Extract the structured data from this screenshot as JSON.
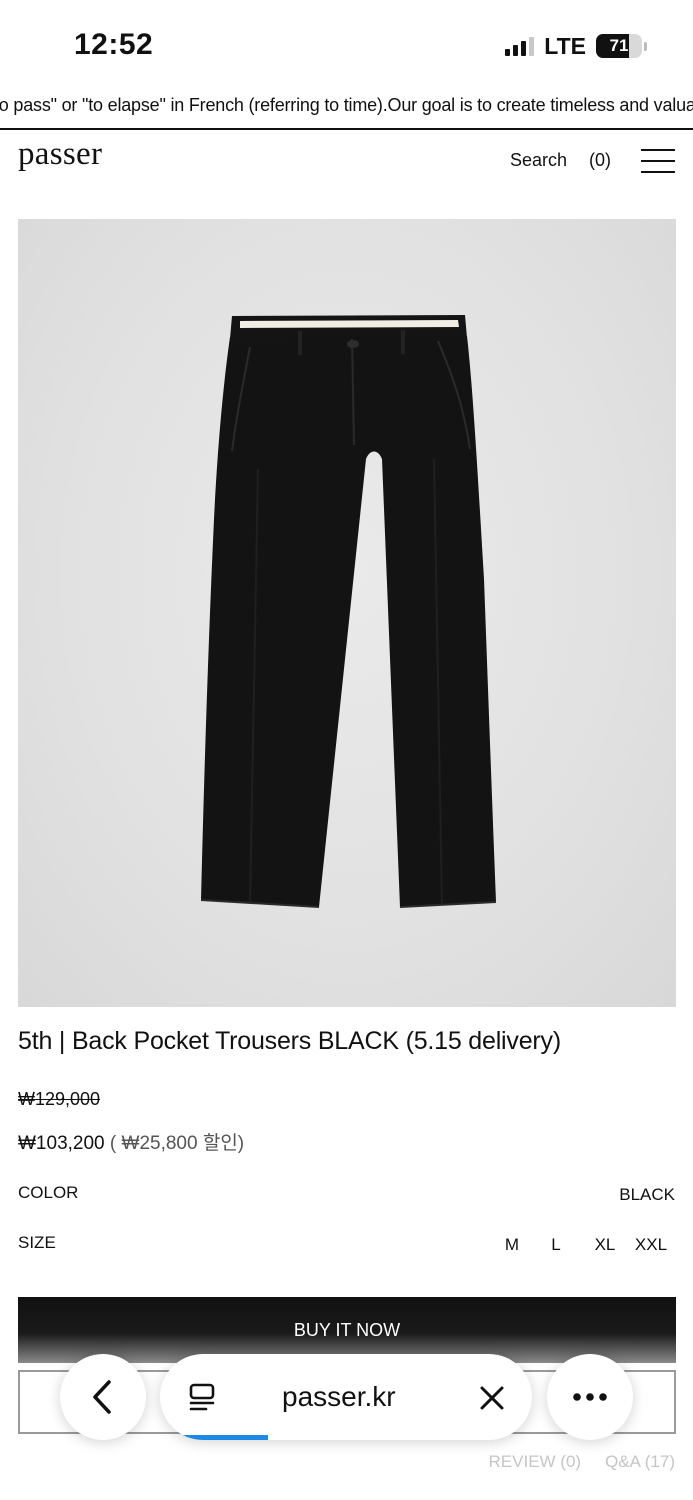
{
  "status_bar": {
    "time": "12:52",
    "network": "LTE",
    "battery": "71",
    "battery_level": 0.71,
    "signal_bars_active": 3
  },
  "announcement": {
    "text": "to pass\" or \"to elapse\" in French (referring to time).Our goal is to create timeless and valua"
  },
  "header": {
    "logo": "passer",
    "search_label": "Search",
    "cart_label": "(0)",
    "menu_icon": "hamburger-menu-icon"
  },
  "product": {
    "image_alt": "black-trousers",
    "title": "5th | Back Pocket Trousers BLACK (5.15 delivery)",
    "price_original": "₩129,000",
    "price_sale": "₩103,200",
    "price_discount": "( ₩25,800 할인)",
    "color_label": "COLOR",
    "color_value": "BLACK",
    "size_label": "SIZE",
    "sizes": [
      "M",
      "L",
      "XL",
      "XXL"
    ]
  },
  "actions": {
    "buy_now": "BUY IT NOW"
  },
  "tabs": [
    "REVIEW (0)",
    "Q&A (17)"
  ],
  "browser": {
    "url": "passer.kr",
    "back_icon": "chevron-left-icon",
    "tabs_icon": "tab-overview-icon",
    "close_icon": "close-icon",
    "more_icon": "more-dots-icon",
    "load_progress": 0.29
  },
  "colors": {
    "text": "#111111",
    "image_bg": "#e3e3e3",
    "muted": "#c5c5c5",
    "progress": "#1e88e5"
  }
}
